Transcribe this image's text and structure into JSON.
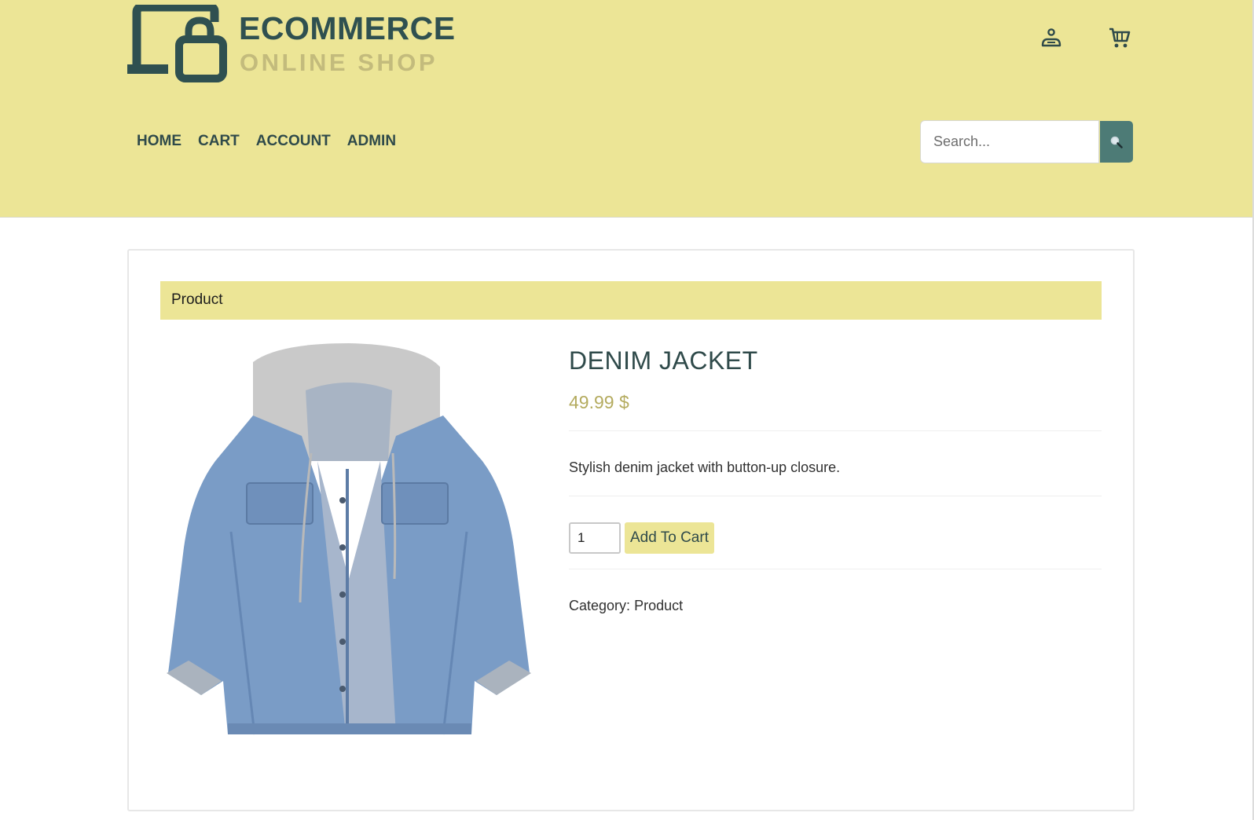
{
  "brand": {
    "line1": "ECOMMERCE",
    "line2": "ONLINE SHOP"
  },
  "header_icons": {
    "account": "user-icon",
    "cart": "cart-icon"
  },
  "nav": {
    "items": [
      {
        "label": "HOME"
      },
      {
        "label": "CART"
      },
      {
        "label": "ACCOUNT"
      },
      {
        "label": "ADMIN"
      }
    ]
  },
  "search": {
    "placeholder": "Search...",
    "value": "",
    "button_icon": "search-icon"
  },
  "panel": {
    "heading": "Product"
  },
  "product": {
    "name": "DENIM JACKET",
    "price": "49.99 $",
    "description": "Stylish denim jacket with button-up closure.",
    "quantity": "1",
    "add_to_cart_label": "Add To Cart",
    "category_label": "Category:",
    "category_value": "Product",
    "image": "denim-jacket-photo"
  },
  "colors": {
    "header_bg": "#ece596",
    "accent_dark": "#2f5050",
    "accent_muted": "#c3bb7c",
    "search_button": "#4d7b76",
    "price": "#b4ab5f"
  }
}
